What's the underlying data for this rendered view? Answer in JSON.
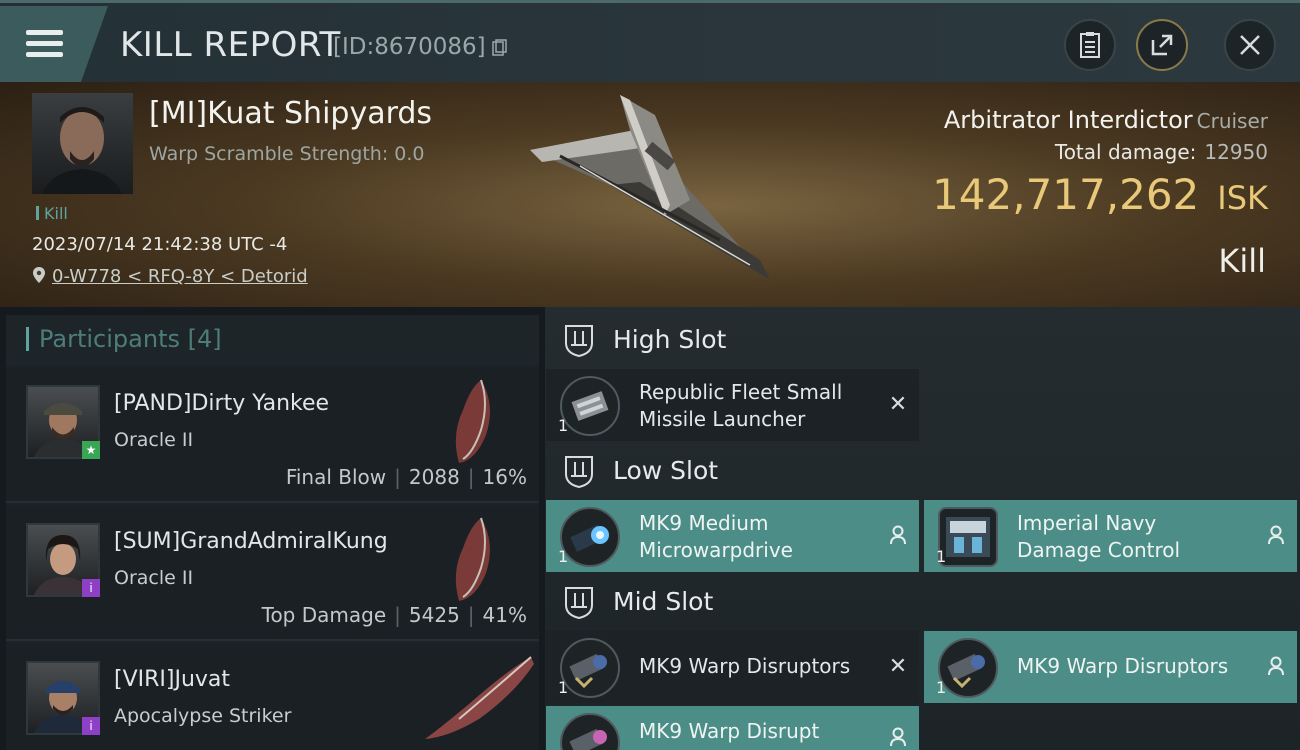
{
  "header": {
    "title": "KILL REPORT",
    "id_text": "[ID:8670086]",
    "menu_icon": "hamburger-icon",
    "buttons": [
      "clipboard-icon",
      "share-icon",
      "close-icon"
    ]
  },
  "victim": {
    "name": "[MI]Kuat Shipyards",
    "warp_scramble": "Warp Scramble Strength: 0.0",
    "tag": "Kill",
    "datetime": "2023/07/14 21:42:38 UTC -4",
    "location": "0-W778 < RFQ-8Y < Detorid",
    "ship_name": "Arbitrator Interdictor",
    "ship_class": "Cruiser",
    "total_damage_label": "Total damage:",
    "total_damage": "12950",
    "isk_value": "142,717,262",
    "isk_unit": "ISK",
    "result": "Kill"
  },
  "participants": {
    "title": "Participants [4]",
    "rows": [
      {
        "name": "[PAND]Dirty Yankee",
        "ship": "Oracle II",
        "role": "Final Blow",
        "damage": "2088",
        "percent": "16%",
        "badge_color": "#3aa655",
        "badge": "★"
      },
      {
        "name": "[SUM]GrandAdmiralKung",
        "ship": "Oracle II",
        "role": "Top Damage",
        "damage": "5425",
        "percent": "41%",
        "badge_color": "#8d3fc6",
        "badge": "i"
      },
      {
        "name": "[VIRI]Juvat",
        "ship": "Apocalypse Striker",
        "role": "",
        "damage": "",
        "percent": "",
        "badge_color": "#8d3fc6",
        "badge": "i"
      }
    ]
  },
  "slots": {
    "high": {
      "label": "High Slot",
      "modules": [
        {
          "name_line1": "Republic Fleet Small",
          "name_line2": "Missile Launcher",
          "qty": "1",
          "status": "destroyed"
        }
      ]
    },
    "low": {
      "label": "Low Slot",
      "modules": [
        {
          "name_line1": "MK9 Medium",
          "name_line2": "Microwarpdrive",
          "qty": "1",
          "status": "dropped"
        },
        {
          "name_line1": "Imperial Navy",
          "name_line2": "Damage Control",
          "qty": "1",
          "status": "dropped"
        }
      ]
    },
    "mid": {
      "label": "Mid Slot",
      "modules": [
        {
          "name_line1": "MK9 Warp Disruptors",
          "qty": "1",
          "status": "destroyed"
        },
        {
          "name_line1": "MK9 Warp Disruptors",
          "qty": "1",
          "status": "dropped"
        },
        {
          "name_line1": "MK9 Warp Disrupt",
          "qty": "",
          "status": "dropped"
        }
      ]
    }
  },
  "colors": {
    "accent_teal": "#4c8e87",
    "isk_gold": "#e8c879",
    "background": "#141a1e"
  }
}
